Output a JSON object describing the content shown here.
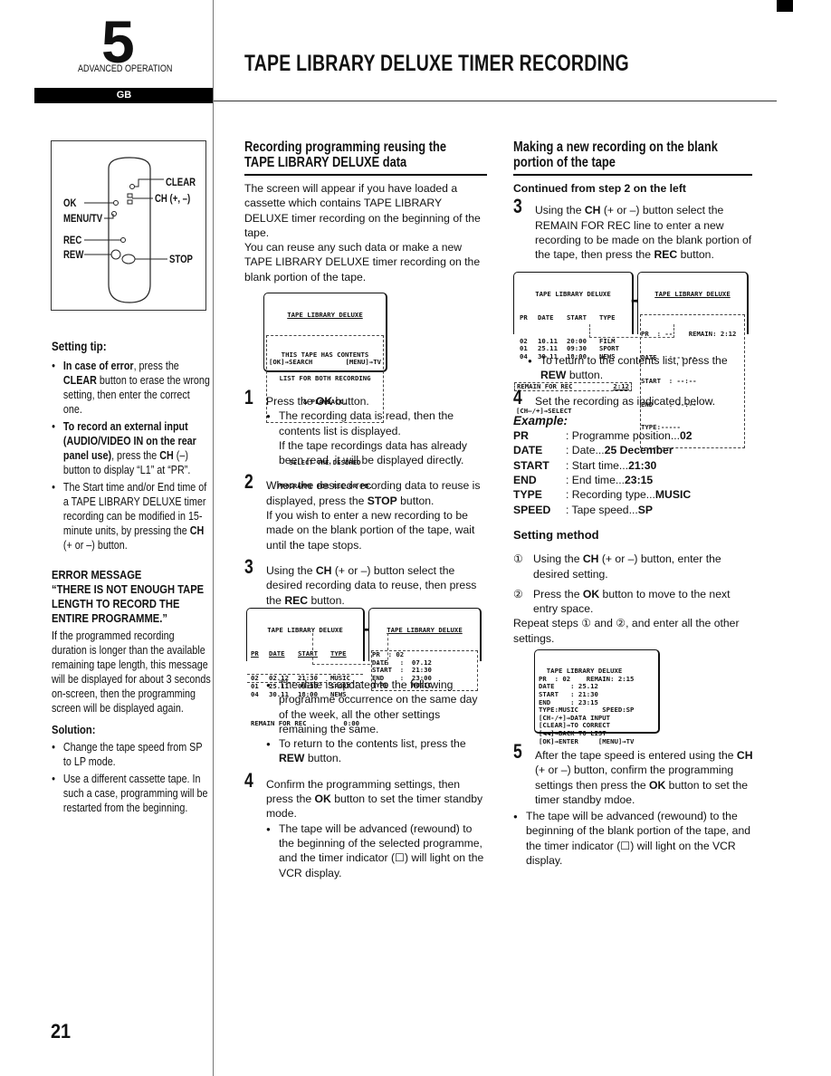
{
  "header": {
    "chapter_number": "5",
    "chapter_label": "ADVANCED OPERATION",
    "language_tab": "GB",
    "page_title": "TAPE LIBRARY DELUXE TIMER RECORDING"
  },
  "sidebar": {
    "remote_labels": {
      "clear": "CLEAR",
      "ch": "CH (+, –)",
      "ok": "OK",
      "menu_tv": "MENU/TV",
      "rec": "REC",
      "rew": "REW",
      "stop": "STOP"
    },
    "setting_tip": {
      "heading": "Setting tip:",
      "items": [
        {
          "bold": "In case of error",
          "text": ", press the ",
          "bold2": "CLEAR",
          "text2": " button to erase the wrong setting, then enter the correct one."
        },
        {
          "bold": "To record an external input (AUDIO/VIDEO IN on the rear panel use)",
          "text": ", press the ",
          "bold2": "CH",
          "text2": " (–) button to display “L1” at “PR”."
        },
        {
          "bold": "",
          "text": "The Start time and/or End time of a TAPE LIBRARY DELUXE timer recording can be modified in 15-minute units, by pressing the ",
          "bold2": "CH",
          "text2": " (+ or –) button."
        }
      ]
    },
    "error_message": {
      "heading": "ERROR MESSAGE",
      "quote": "“THERE IS NOT ENOUGH TAPE LENGTH TO RECORD THE ENTIRE PROGRAMME.”",
      "body": "If the programmed recording duration is longer than the available remaining tape length, this message will be displayed for about 3 seconds on-screen, then the programming screen will be displayed again."
    },
    "solution": {
      "heading": "Solution:",
      "items": [
        "Change the tape speed from SP to LP mode.",
        "Use a different cassette tape. In such a case, programming will be restarted from the beginning."
      ]
    },
    "page_number": "21"
  },
  "left_column": {
    "title_line1": "Recording programming reusing the",
    "title_line2": "TAPE LIBRARY DELUXE data",
    "intro1": "The screen will appear if you have loaded a cassette which contains TAPE LIBRARY DELUXE timer recording on the beginning of the tape.",
    "intro2": "You can reuse any such data or make a new TAPE LIBRARY DELUXE timer recording on the blank portion of the tape.",
    "osd_intro": {
      "title": "TAPE LIBRARY DELUXE",
      "box_lines": [
        "THIS TAPE HAS CONTENTS",
        "LIST FOR BOTH RECORDING",
        "& PLAYBACK."
      ],
      "select_lines": [
        "SELECT THE DESIRED",
        "PROGRAMME FOR REC.OR PB."
      ],
      "footer_left": "[OK]→SEARCH",
      "footer_right": "[MENU]→TV"
    },
    "steps": [
      {
        "num": "1",
        "pre": "Press the ",
        "bold": "OK",
        "post": " button.",
        "bullets": [
          "The recording data is read, then the contents list is displayed.\nIf the tape recordings data has already been read, it will be displayed directly."
        ]
      },
      {
        "num": "2",
        "pre": "When the desired recording data to reuse is displayed, press the ",
        "bold": "STOP",
        "post": " button.",
        "extra": "If you wish to enter a new recording to be made on the blank portion of the tape, wait until the tape stops."
      },
      {
        "num": "3",
        "pre": "Using the ",
        "bold": "CH",
        "post": " (+ or –) button select the desired recording data to reuse, then press the ",
        "bold2": "REC",
        "post2": " button."
      }
    ],
    "osd_list": {
      "title": "TAPE LIBRARY DELUXE",
      "headers": [
        "PR",
        "DATE",
        "START",
        "TYPE"
      ],
      "rows": [
        [
          "02",
          "02.12",
          "21:30",
          "MUSIC"
        ],
        [
          "01",
          "25.11",
          "09:30",
          "SPORT"
        ],
        [
          "04",
          "30.11",
          "18:00",
          "NEWS"
        ]
      ],
      "remain_label": "REMAIN FOR REC",
      "remain_value": "0:00"
    },
    "osd_detail": {
      "title": "TAPE LIBRARY DELUXE",
      "lines": [
        [
          "PR",
          "02"
        ],
        [
          "DATE",
          "07.12"
        ],
        [
          "START",
          "21:30"
        ],
        [
          "END",
          "23:00"
        ],
        [
          "TYPE",
          "MUSIC"
        ]
      ]
    },
    "step3_bullets": [
      "The date is updated to the following programme occurrence on the same day of the week, all the other settings remaining the same.",
      {
        "pre": "To return to the contents list, press the ",
        "bold": "REW",
        "post": " button."
      }
    ],
    "step4": {
      "num": "4",
      "pre": "Confirm the programming settings, then press the ",
      "bold": "OK",
      "post": " button to set the timer standby mode.",
      "bullet": "The tape will be advanced (rewound) to the beginning of the selected programme, and the timer indicator (☐) will light on the VCR display."
    }
  },
  "right_column": {
    "title_line1": "Making a new recording on the blank",
    "title_line2": "portion of the tape",
    "continued": "Continued from step 2 on the left",
    "step3": {
      "num": "3",
      "pre": "Using the ",
      "bold": "CH",
      "mid": " (+ or –) button select the REMAIN FOR REC line to enter a new recording to be made on the blank portion of the tape, then press the ",
      "bold2": "REC",
      "post": " button."
    },
    "osd_list": {
      "title": "TAPE LIBRARY DELUXE",
      "headers": [
        "PR",
        "DATE",
        "START",
        "TYPE"
      ],
      "rows": [
        [
          "02",
          "10.11",
          "20:00",
          "FILM"
        ],
        [
          "01",
          "25.11",
          "09:30",
          "SPORT"
        ],
        [
          "04",
          "30.11",
          "18:00",
          "NEWS"
        ]
      ],
      "remain_label": "REMAIN FOR REC",
      "remain_value": "2:12",
      "footer": "[CH–/+]→SELECT"
    },
    "osd_blank": {
      "title": "TAPE LIBRARY DELUXE",
      "pr_line": "PR  : --    REMAIN: 2:12",
      "lines": [
        "DATE   : --.--",
        "START  : --:--",
        "END    : --:--",
        "TYPE:-----"
      ]
    },
    "step3_bullet": {
      "pre": "To return to the contents list, press the ",
      "bold": "REW",
      "post": " button."
    },
    "step4": {
      "num": "4",
      "text": "Set the recording as indicated below."
    },
    "example": {
      "heading": "Example:",
      "rows": [
        {
          "key": "PR",
          "desc": ": Programme position... ",
          "value": "02"
        },
        {
          "key": "DATE",
          "desc": ": Date... ",
          "value": "25 December"
        },
        {
          "key": "START",
          "desc": ": Start time... ",
          "value": "21:30"
        },
        {
          "key": "END",
          "desc": ": End time... ",
          "value": "23:15"
        },
        {
          "key": "TYPE",
          "desc": ": Recording type... ",
          "value": "MUSIC"
        },
        {
          "key": "SPEED",
          "desc": ": Tape speed... ",
          "value": "SP"
        }
      ]
    },
    "setting_method": {
      "heading": "Setting method",
      "sub1": {
        "mark": "①",
        "pre": "Using the ",
        "bold": "CH",
        "post": " (+ or –) button, enter the desired setting."
      },
      "sub2": {
        "mark": "②",
        "pre": "Press the ",
        "bold": "OK",
        "post": " button to move to the next entry space."
      },
      "repeat": "Repeat steps ① and ②, and enter all the other settings."
    },
    "osd_edit": {
      "lines": [
        "  TAPE LIBRARY DELUXE",
        "PR  : 02    REMAIN: 2:15",
        "DATE    : 25.12",
        "START   : 21:30",
        "END     : 23:15",
        "TYPE:MUSIC      SPEED:SP",
        "[CH-/+]→DATA INPUT",
        "[CLEAR]→TO CORRECT",
        "[◀◀]→BACK TO LIST",
        "[OK]→ENTER     [MENU]→TV"
      ]
    },
    "step5": {
      "num": "5",
      "pre": "After the tape speed is entered using the ",
      "bold": "CH",
      "mid": " (+ or –) button, confirm the programming settings then press the ",
      "bold2": "OK",
      "post": " button to set the timer standby mdoe."
    },
    "step5_bullet": "The tape will be advanced (rewound) to the beginning of the blank portion of the tape, and the timer indicator (☐) will light on the VCR display."
  }
}
